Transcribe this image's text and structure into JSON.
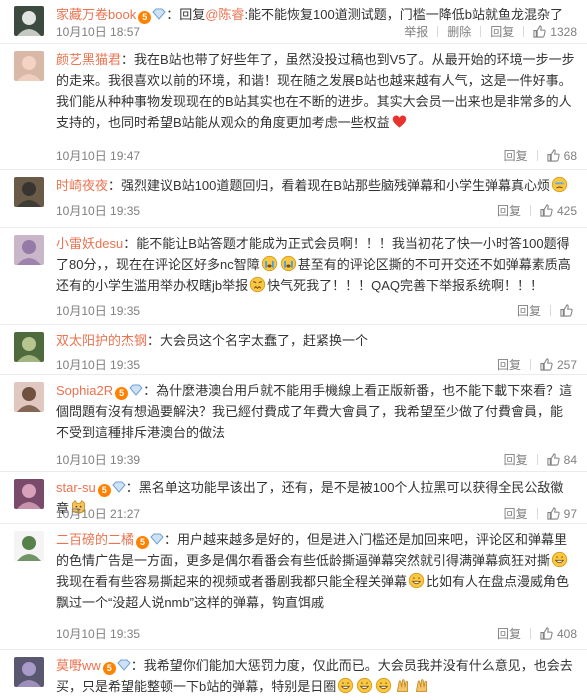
{
  "comments": [
    {
      "user": "家藏万卷book",
      "badge": "5",
      "segments": [
        {
          "t": "text",
          "v": "："
        },
        {
          "t": "text",
          "v": "回复"
        },
        {
          "t": "mention",
          "v": "@陈睿"
        },
        {
          "t": "text",
          "v": ":能不能恢复100道测试题，门槛一降低b站就鱼龙混杂了"
        }
      ],
      "time": "10月10日 18:57",
      "actions": [
        "举报",
        "删除",
        "回复"
      ],
      "likes": "1328",
      "avatar_color": "#3d4a3f"
    },
    {
      "user": "颜艺黑猫君",
      "badge": "",
      "segments": [
        {
          "t": "text",
          "v": "：我在B站也带了好些年了，虽然没投过稿也到V5了。从最开始的环境一步一步的走来。我很喜欢以前的环境，和谐！现在随之发展B站也越来越有人气，这是一件好事。我们能从种种事物发现现在的B站其实也在不断的进步。其实大会员一出来也是非常多的人支持的，也同时希望B站能从观众的角度更加考虑一些权益"
        },
        {
          "t": "emoji",
          "v": "heart"
        }
      ],
      "time": "10月10日 19:47",
      "actions": [
        "回复"
      ],
      "likes": "68",
      "avatar_color": "#d9b8a8"
    },
    {
      "user": "时崎夜夜",
      "badge": "",
      "segments": [
        {
          "t": "text",
          "v": "：强烈建议B站100道题回归，看着现在B站那些脑残弹幕和小学生弹幕真心烦"
        },
        {
          "t": "emoji",
          "v": "sweat"
        }
      ],
      "time": "10月10日 19:35",
      "actions": [
        "回复"
      ],
      "likes": "425",
      "avatar_color": "#6a5a48"
    },
    {
      "user": "小雷妖desu",
      "badge": "",
      "segments": [
        {
          "t": "text",
          "v": "：能不能让B站答题才能成为正式会员啊！！！我当初花了快一小时答100题得了80分，，现在在评论区好多nc智障"
        },
        {
          "t": "emoji",
          "v": "cry"
        },
        {
          "t": "emoji",
          "v": "cry"
        },
        {
          "t": "text",
          "v": "甚至有的评论区撕的不可开交还不如弹幕素质高还有的小学生滥用举办权瞎jb举报"
        },
        {
          "t": "emoji",
          "v": "angry"
        },
        {
          "t": "text",
          "v": "快气死我了！！！QAQ完善下举报系统啊！！！"
        }
      ],
      "time": "10月10日 19:35",
      "actions": [
        "回复"
      ],
      "likes": "",
      "avatar_color": "#c9b6c8"
    },
    {
      "user": "双太阳护的杰钢",
      "badge": "",
      "segments": [
        {
          "t": "text",
          "v": "：大会员这个名字太蠢了，赶紧换一个"
        }
      ],
      "time": "10月10日 19:35",
      "actions": [
        "回复"
      ],
      "likes": "257",
      "avatar_color": "#4f6b3e"
    },
    {
      "user": "Sophia2R",
      "badge": "5",
      "segments": [
        {
          "t": "text",
          "v": "：為什麼港澳台用戶就不能用手機線上看正版新番，也不能下載下來看？這個問題有沒有想過要解決？我已經付費成了年費大會員了，我希望至少做了付費會員，能不受到這種排斥港澳台的做法"
        }
      ],
      "time": "10月10日 19:39",
      "actions": [
        "回复"
      ],
      "likes": "84",
      "avatar_color": "#e0c8c0"
    },
    {
      "user": "star-su",
      "badge": "5",
      "segments": [
        {
          "t": "text",
          "v": "：黑名单这功能早该出了，还有，是不是被100个人拉黑可以获得全民公敌徽章"
        },
        {
          "t": "emoji",
          "v": "cat"
        }
      ],
      "time": "10月10日 21:27",
      "actions": [
        "回复"
      ],
      "likes": "97",
      "avatar_color": "#7a4a6a"
    },
    {
      "user": "二百磅的二橘",
      "badge": "5",
      "segments": [
        {
          "t": "text",
          "v": "：用户越来越多是好的，但是进入门槛还是加回来吧，评论区和弹幕里的色情广告是一方面，更多是偶尔看番会有些低龄撕逼弹幕突然就引得满弹幕疯狂对撕"
        },
        {
          "t": "emoji",
          "v": "grin"
        },
        {
          "t": "text",
          "v": "我现在看有些容易撕起来的视频或者番剧我都只能全程关弹幕"
        },
        {
          "t": "emoji",
          "v": "grin"
        },
        {
          "t": "text",
          "v": "比如有人在盘点漫威角色飘过一个“没超人说nmb”这样的弹幕，钩直饵戚"
        }
      ],
      "time": "10月10日 19:35",
      "actions": [
        "回复"
      ],
      "likes": "408",
      "avatar_color": "#f4f4f4"
    },
    {
      "user": "莫嘢ww",
      "badge": "5",
      "segments": [
        {
          "t": "text",
          "v": "：我希望你们能加大惩罚力度，仅此而已。大会员我并没有什么意见，也会去买，只是希望能整顿一下b站的弹幕，特别是日圈"
        },
        {
          "t": "emoji",
          "v": "grin"
        },
        {
          "t": "emoji",
          "v": "grin"
        },
        {
          "t": "emoji",
          "v": "grin"
        },
        {
          "t": "emoji",
          "v": "hands"
        },
        {
          "t": "emoji",
          "v": "hands"
        }
      ],
      "time": "",
      "actions": [],
      "likes": "",
      "avatar_color": "#5a5870"
    }
  ]
}
